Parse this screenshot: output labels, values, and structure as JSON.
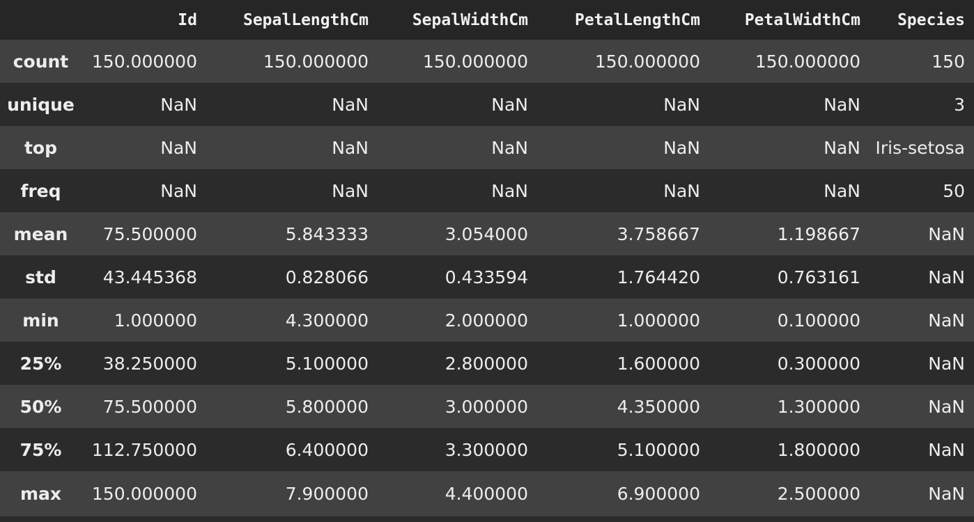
{
  "columns": [
    "Id",
    "SepalLengthCm",
    "SepalWidthCm",
    "PetalLengthCm",
    "PetalWidthCm",
    "Species"
  ],
  "rows": [
    {
      "label": "count",
      "values": [
        "150.000000",
        "150.000000",
        "150.000000",
        "150.000000",
        "150.000000",
        "150"
      ]
    },
    {
      "label": "unique",
      "values": [
        "NaN",
        "NaN",
        "NaN",
        "NaN",
        "NaN",
        "3"
      ]
    },
    {
      "label": "top",
      "values": [
        "NaN",
        "NaN",
        "NaN",
        "NaN",
        "NaN",
        "Iris-setosa"
      ]
    },
    {
      "label": "freq",
      "values": [
        "NaN",
        "NaN",
        "NaN",
        "NaN",
        "NaN",
        "50"
      ]
    },
    {
      "label": "mean",
      "values": [
        "75.500000",
        "5.843333",
        "3.054000",
        "3.758667",
        "1.198667",
        "NaN"
      ]
    },
    {
      "label": "std",
      "values": [
        "43.445368",
        "0.828066",
        "0.433594",
        "1.764420",
        "0.763161",
        "NaN"
      ]
    },
    {
      "label": "min",
      "values": [
        "1.000000",
        "4.300000",
        "2.000000",
        "1.000000",
        "0.100000",
        "NaN"
      ]
    },
    {
      "label": "25%",
      "values": [
        "38.250000",
        "5.100000",
        "2.800000",
        "1.600000",
        "0.300000",
        "NaN"
      ]
    },
    {
      "label": "50%",
      "values": [
        "75.500000",
        "5.800000",
        "3.000000",
        "4.350000",
        "1.300000",
        "NaN"
      ]
    },
    {
      "label": "75%",
      "values": [
        "112.750000",
        "6.400000",
        "3.300000",
        "5.100000",
        "1.800000",
        "NaN"
      ]
    },
    {
      "label": "max",
      "values": [
        "150.000000",
        "7.900000",
        "4.400000",
        "6.900000",
        "2.500000",
        "NaN"
      ]
    }
  ]
}
